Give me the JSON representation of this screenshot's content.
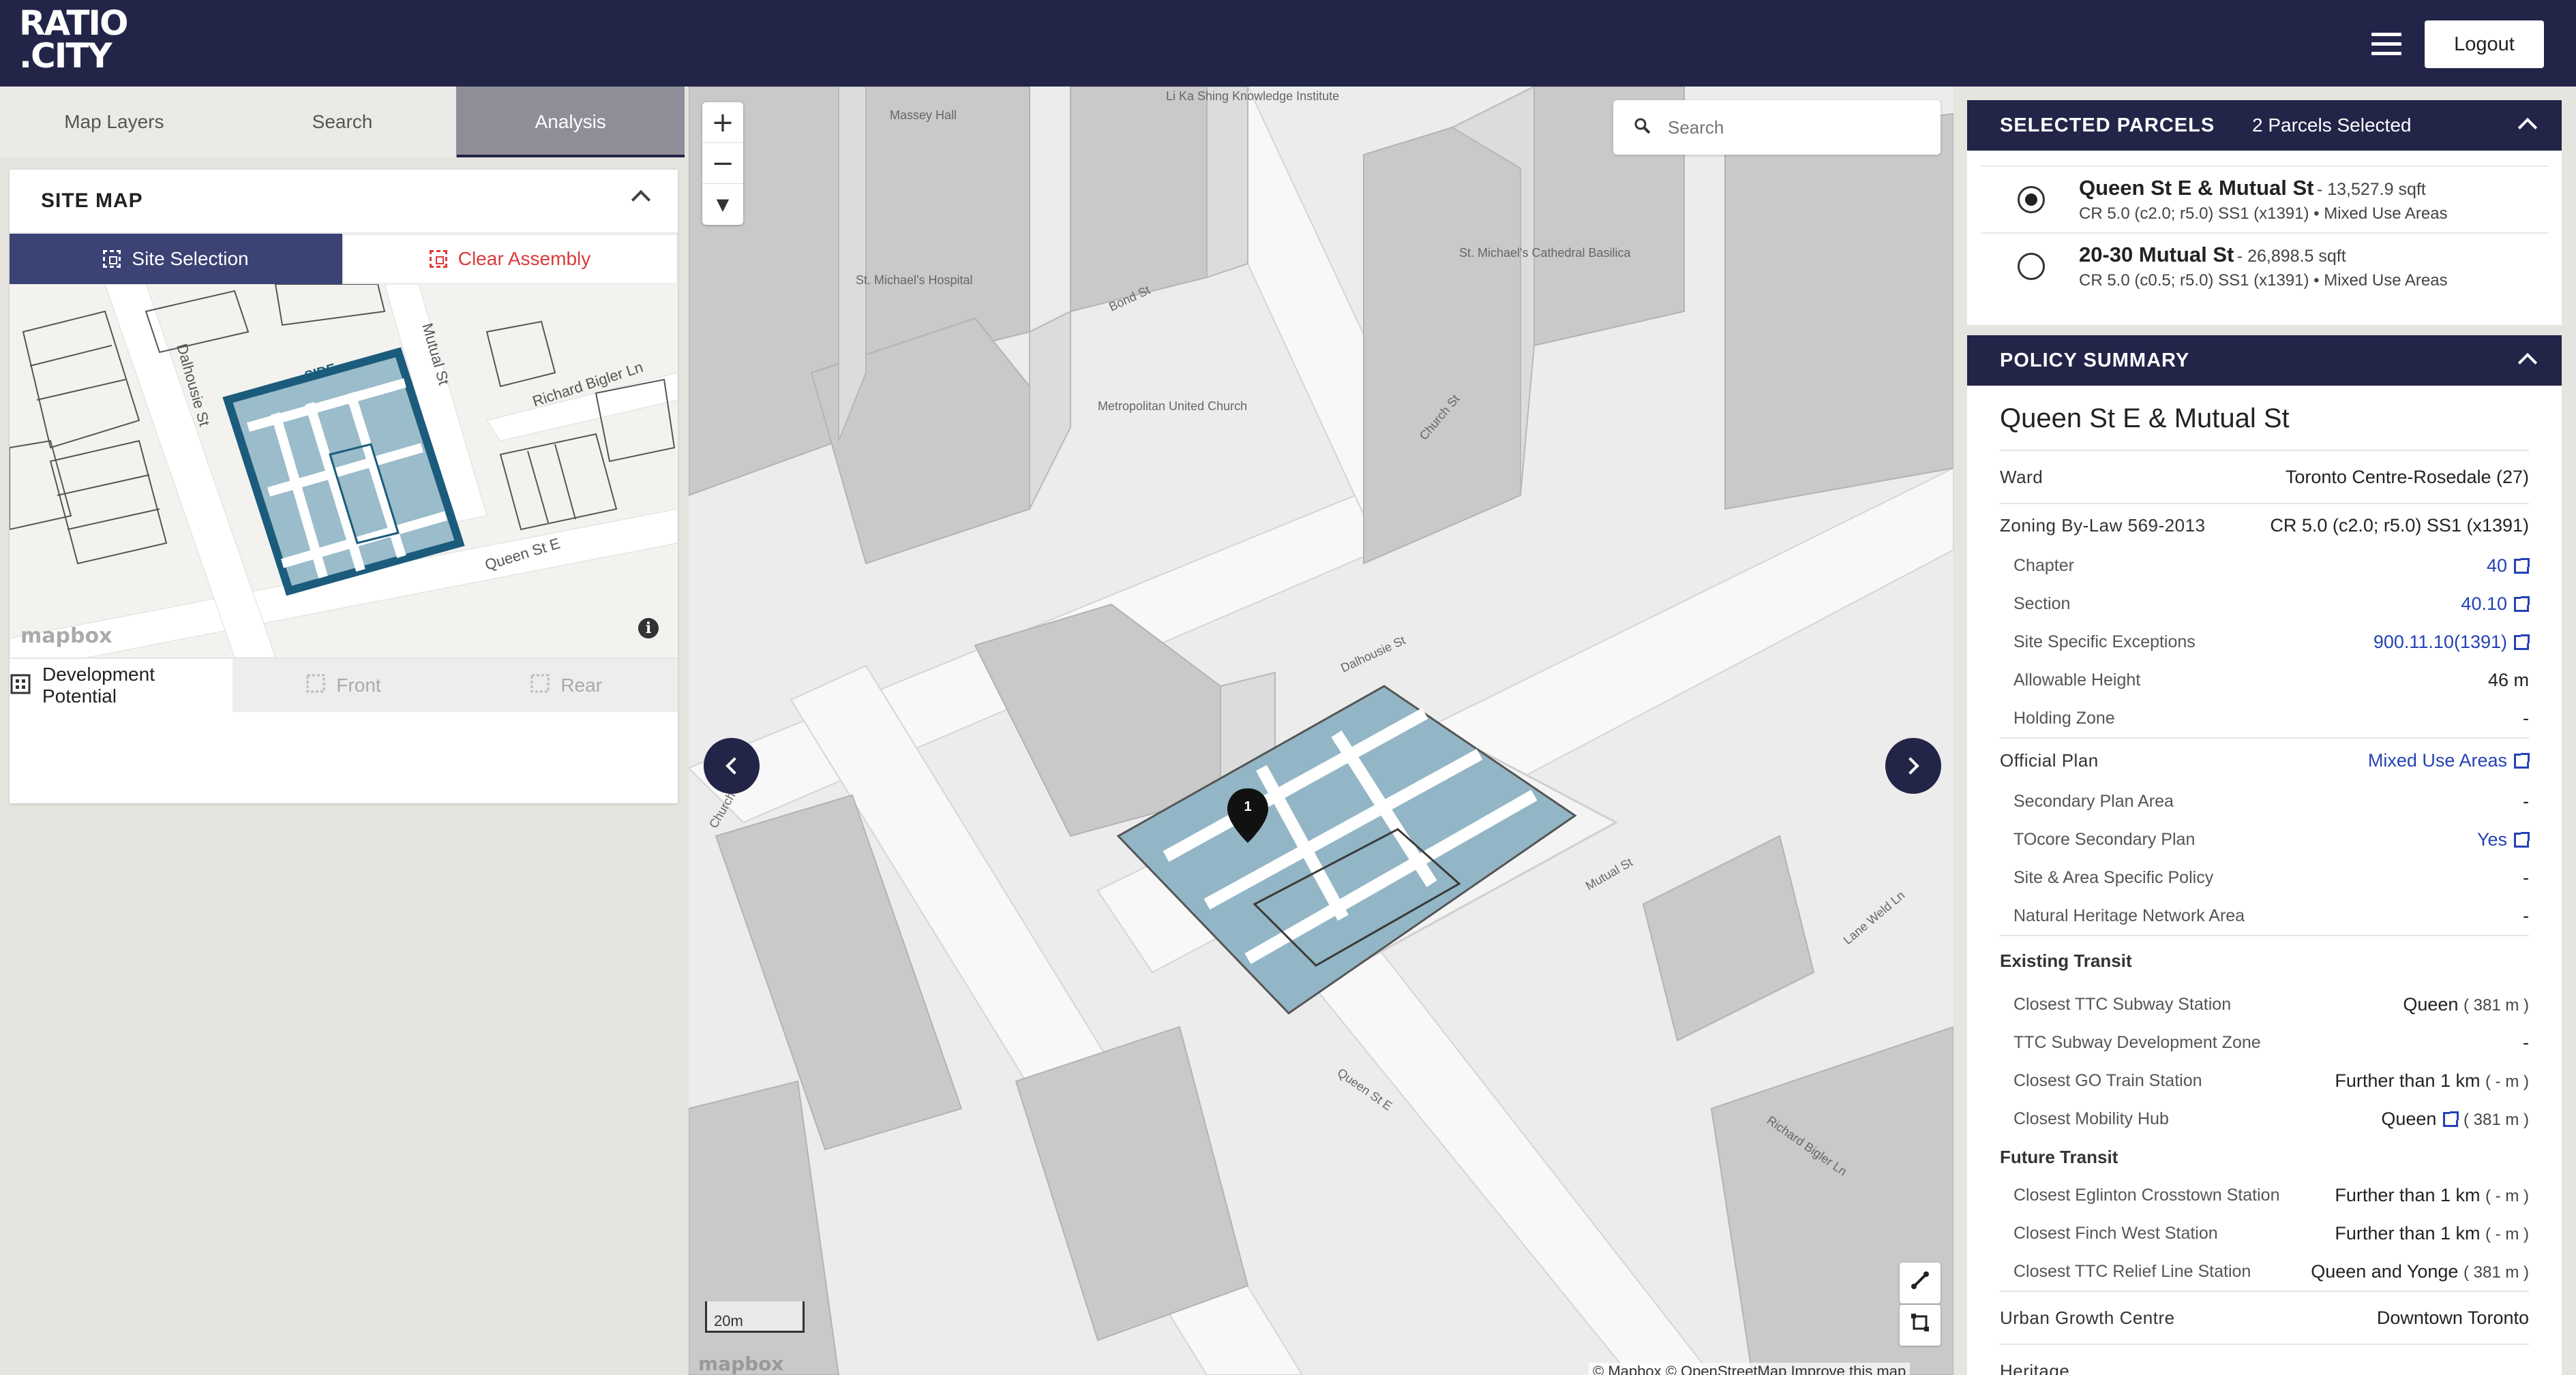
{
  "app": {
    "logo_line1": "RATIO",
    "logo_line2": ".CITY",
    "logout_label": "Logout"
  },
  "left_tabs": [
    {
      "label": "Map Layers"
    },
    {
      "label": "Search"
    },
    {
      "label": "Analysis",
      "active": true
    }
  ],
  "site_map": {
    "title": "SITE MAP",
    "site_selection_label": "Site Selection",
    "clear_assembly_label": "Clear Assembly",
    "map_labels": {
      "dalhousie": "Dalhousie St",
      "mutual": "Mutual St",
      "richard": "Richard Bigler Ln",
      "queen": "Queen St E",
      "side": "SIDE"
    },
    "mapbox": "mapbox",
    "info_icon": "i",
    "buttons": [
      {
        "label": "Development Potential",
        "enabled": true
      },
      {
        "label": "Front",
        "enabled": false
      },
      {
        "label": "Rear",
        "enabled": false
      }
    ]
  },
  "map": {
    "search_placeholder": "Search",
    "zoom_in": "+",
    "zoom_out": "−",
    "compass": "▼",
    "scale_label": "20m",
    "attribution": "© Mapbox © OpenStreetMap  Improve this map",
    "mapbox": "mapbox",
    "marker_number": "1",
    "labels": {
      "massey": "Massey Hall",
      "likashing": "Li Ka Shing Knowledge Institute",
      "stmichaels_hosp": "St. Michael's Hospital",
      "cathedral": "St. Michael's Cathedral Basilica",
      "metropolitan": "Metropolitan United Church",
      "bond": "Bond St",
      "church": "Church St",
      "dalhousie": "Dalhousie St",
      "mutual": "Mutual St",
      "queen": "Queen St E",
      "richard": "Richard Bigler Ln",
      "laneweld": "Lane Weld Ln",
      "church2": "Church"
    }
  },
  "selected_parcels": {
    "title": "SELECTED PARCELS",
    "count_label": "2 Parcels Selected",
    "items": [
      {
        "name": "Queen St E & Mutual St",
        "area": "- 13,527.9 sqft",
        "details": "CR 5.0 (c2.0; r5.0) SS1 (x1391) • Mixed Use Areas",
        "selected": true
      },
      {
        "name": "20-30 Mutual St",
        "area": "- 26,898.5 sqft",
        "details": "CR 5.0 (c0.5; r5.0) SS1 (x1391) • Mixed Use Areas",
        "selected": false
      }
    ]
  },
  "policy": {
    "header": "POLICY SUMMARY",
    "title": "Queen St E & Mutual St",
    "ward_label": "Ward",
    "ward_value": "Toronto Centre-Rosedale (27)",
    "zoning_label": "Zoning By-Law 569-2013",
    "zoning_value": "CR 5.0 (c2.0; r5.0) SS1 (x1391)",
    "chapter_label": "Chapter",
    "chapter_value": "40",
    "section_label": "Section",
    "section_value": "40.10",
    "sse_label": "Site Specific Exceptions",
    "sse_value": "900.11.10(1391)",
    "height_label": "Allowable Height",
    "height_value": "46 m",
    "holding_label": "Holding Zone",
    "holding_value": "-",
    "op_label": "Official Plan",
    "op_value": "Mixed Use Areas",
    "secondary_label": "Secondary Plan Area",
    "secondary_value": "-",
    "tocore_label": "TOcore Secondary Plan",
    "tocore_value": "Yes",
    "sasp_label": "Site & Area Specific Policy",
    "sasp_value": "-",
    "nhn_label": "Natural Heritage Network Area",
    "nhn_value": "-",
    "existing_transit": "Existing Transit",
    "subway_label": "Closest TTC Subway Station",
    "subway_value": "Queen",
    "subway_dist": "( 381 m )",
    "subway_zone_label": "TTC Subway Development Zone",
    "subway_zone_value": "-",
    "go_label": "Closest GO Train Station",
    "go_value": "Further than 1 km",
    "go_dist": "( - m )",
    "mobility_label": "Closest Mobility Hub",
    "mobility_value": "Queen",
    "mobility_dist": "( 381 m )",
    "future_transit": "Future Transit",
    "eglinton_label": "Closest Eglinton Crosstown Station",
    "eglinton_value": "Further than 1 km",
    "eglinton_dist": "( - m )",
    "finch_label": "Closest Finch West Station",
    "finch_value": "Further than 1 km",
    "finch_dist": "( - m )",
    "relief_label": "Closest TTC Relief Line Station",
    "relief_value": "Queen and Yonge",
    "relief_dist": "( 381 m )",
    "ugc_label": "Urban Growth Centre",
    "ugc_value": "Downtown Toronto",
    "heritage_label": "Heritage"
  }
}
